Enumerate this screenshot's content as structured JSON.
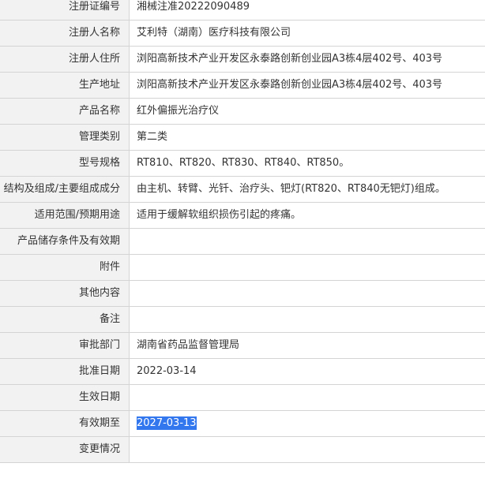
{
  "rows": [
    {
      "label": "注册证编号",
      "value": "湘械注准20222090489"
    },
    {
      "label": "注册人名称",
      "value": "艾利特（湖南）医疗科技有限公司"
    },
    {
      "label": "注册人住所",
      "value": "浏阳高新技术产业开发区永泰路创新创业园A3栋4层402号、403号"
    },
    {
      "label": "生产地址",
      "value": "浏阳高新技术产业开发区永泰路创新创业园A3栋4层402号、403号"
    },
    {
      "label": "产品名称",
      "value": "红外偏振光治疗仪"
    },
    {
      "label": "管理类别",
      "value": "第二类"
    },
    {
      "label": "型号规格",
      "value": "RT810、RT820、RT830、RT840、RT850。"
    },
    {
      "label": "结构及组成/主要组成成分",
      "value": "由主机、转臂、光钎、治疗头、钯灯(RT820、RT840无钯灯)组成。"
    },
    {
      "label": "适用范围/预期用途",
      "value": "适用于缓解软组织损伤引起的疼痛。"
    },
    {
      "label": "产品储存条件及有效期",
      "value": ""
    },
    {
      "label": "附件",
      "value": ""
    },
    {
      "label": "其他内容",
      "value": ""
    },
    {
      "label": "备注",
      "value": ""
    },
    {
      "label": "审批部门",
      "value": "湖南省药品监督管理局"
    },
    {
      "label": "批准日期",
      "value": "2022-03-14"
    },
    {
      "label": "生效日期",
      "value": ""
    },
    {
      "label": "有效期至",
      "value": "2027-03-13"
    },
    {
      "label": "变更情况",
      "value": ""
    }
  ],
  "selection": {
    "color": "#3377ee",
    "row": "有效期至"
  }
}
